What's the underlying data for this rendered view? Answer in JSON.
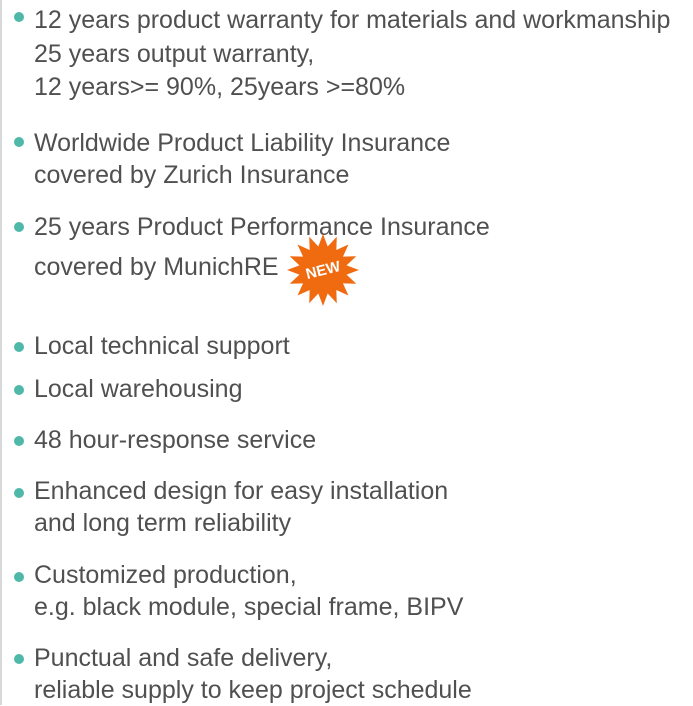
{
  "items": [
    {
      "lines": [
        "12 years product warranty for materials and workmanship",
        "25 years output warranty,",
        "12 years>= 90%, 25years >=80%"
      ]
    },
    {
      "lines": [
        "Worldwide Product Liability Insurance",
        "covered by Zurich Insurance"
      ]
    },
    {
      "lines": [
        "25 years Product Performance Insurance",
        "covered by MunichRE"
      ]
    },
    {
      "lines": [
        "Local technical support"
      ]
    },
    {
      "lines": [
        "Local warehousing"
      ]
    },
    {
      "lines": [
        "48 hour-response service"
      ]
    },
    {
      "lines": [
        "Enhanced design for easy installation",
        "and long term reliability"
      ]
    },
    {
      "lines": [
        "Customized production,",
        "e.g. black module, special frame, BIPV"
      ]
    },
    {
      "lines": [
        "Punctual and safe delivery,",
        "reliable supply to keep project schedule"
      ]
    }
  ],
  "badge": {
    "label": "NEW",
    "color": "#f06a10",
    "text_color": "#ffffff"
  },
  "colors": {
    "bullet": "#4fb8a8",
    "text": "#505050"
  }
}
